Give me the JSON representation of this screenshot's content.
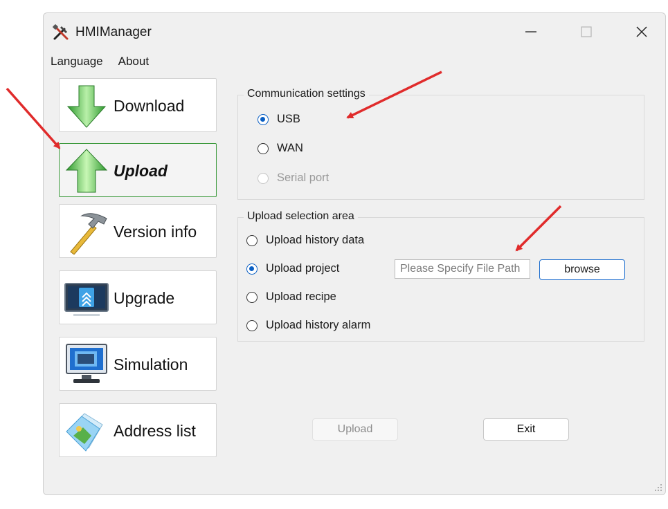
{
  "window": {
    "title": "HMIManager",
    "controls": {
      "minimize": "minimize-icon",
      "maximize": "maximize-icon",
      "close": "close-icon"
    }
  },
  "menu": {
    "items": [
      "Language",
      "About"
    ]
  },
  "sidebar": {
    "items": [
      {
        "label": "Download",
        "icon": "download-arrow-icon",
        "active": false
      },
      {
        "label": "Upload",
        "icon": "upload-arrow-icon",
        "active": true
      },
      {
        "label": "Version info",
        "icon": "hammer-icon",
        "active": false
      },
      {
        "label": "Upgrade",
        "icon": "upgrade-monitor-icon",
        "active": false
      },
      {
        "label": "Simulation",
        "icon": "simulation-monitor-icon",
        "active": false
      },
      {
        "label": "Address list",
        "icon": "address-folder-icon",
        "active": false
      }
    ]
  },
  "communication": {
    "title": "Communication settings",
    "options": [
      {
        "label": "USB",
        "checked": true,
        "disabled": false
      },
      {
        "label": "WAN",
        "checked": false,
        "disabled": false
      },
      {
        "label": "Serial port",
        "checked": false,
        "disabled": true
      }
    ]
  },
  "upload_selection": {
    "title": "Upload selection area",
    "options": [
      {
        "label": "Upload history data",
        "checked": false
      },
      {
        "label": "Upload project",
        "checked": true
      },
      {
        "label": "Upload recipe",
        "checked": false
      },
      {
        "label": "Upload history alarm",
        "checked": false
      }
    ],
    "file_path_placeholder": "Please Specify File Path",
    "file_path_value": "",
    "browse_label": "browse"
  },
  "actions": {
    "upload_label": "Upload",
    "upload_enabled": false,
    "exit_label": "Exit"
  },
  "colors": {
    "window_bg": "#f0f0f0",
    "accent_blue": "#0a5fc4",
    "active_border": "#3c9a3c",
    "annotation_arrow": "#e02b2b"
  },
  "annotations": {
    "arrow_count": 3,
    "arrow_icon": "red-arrow-annotation"
  }
}
